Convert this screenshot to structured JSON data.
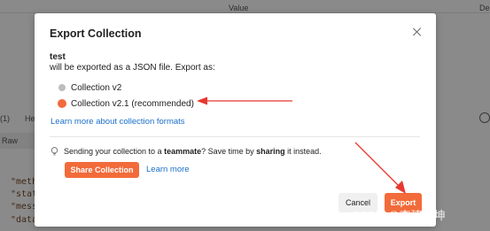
{
  "background": {
    "column_value": "Value",
    "column_de": "De",
    "tab_1": "(1)",
    "tab_2": "He",
    "raw_tab": "Raw",
    "code_lines": [
      "\"meth",
      "\"stat",
      "\"mess",
      "\"data"
    ]
  },
  "modal": {
    "title": "Export Collection",
    "collection_name": "test",
    "description": "will be exported as a JSON file. Export as:",
    "options": [
      {
        "label": "Collection v2",
        "selected": false
      },
      {
        "label": "Collection v2.1 (recommended)",
        "selected": true
      }
    ],
    "learn_link": "Learn more about collection formats",
    "tip": {
      "prefix": "Sending your collection to a ",
      "bold_1": "teammate",
      "middle": "? Save time by ",
      "bold_2": "sharing",
      "suffix": " it instead."
    },
    "share_button": "Share Collection",
    "learn_more": "Learn more",
    "cancel_button": "Cancel",
    "export_button": "Export"
  },
  "colors": {
    "accent": "#f26b3a",
    "link": "#1a6fc9",
    "annotation_arrow": "#e8382f"
  },
  "watermark": "CSDN @李建坤坤"
}
